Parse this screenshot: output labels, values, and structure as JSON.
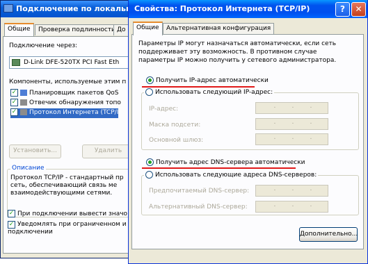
{
  "back_window": {
    "title": "Подключение по локальной",
    "tabs": [
      "Общие",
      "Проверка подлинности",
      "До"
    ],
    "connect_via_label": "Подключение через:",
    "adapter_name": "D-Link DFE-520TX PCI Fast Eth",
    "components_label": "Компоненты, используемые этим п",
    "components": [
      {
        "label": "Планировщик пакетов QoS",
        "checked": true
      },
      {
        "label": "Отвечик обнаружения топо",
        "checked": true
      },
      {
        "label": "Протокол Интернета (TCP/I",
        "checked": true
      }
    ],
    "install_button": "Установить...",
    "remove_button": "Удалить",
    "description_title": "Описание",
    "description_text": "Протокол TCP/IP - стандартный пр сеть, обеспечивающий связь ме взаимодействующими сетями.",
    "show_icon_label": "При подключении вывести значо",
    "notify_label": "Уведомлять при ограниченном и подключении"
  },
  "dialog": {
    "title": "Свойства: Протокол Интернета (TCP/IP)",
    "help_glyph": "?",
    "close_glyph": "✕",
    "tabs": [
      "Общие",
      "Альтернативная конфигурация"
    ],
    "description": "Параметры IP могут назначаться автоматически, если сеть поддерживает эту возможность. В противном случае параметры IP можно получить у сетевого администратора.",
    "ip_auto_label": "Получить IP-адрес автоматически",
    "ip_manual_label": "Использовать следующий IP-адрес:",
    "ip_fields": [
      "IP-адрес:",
      "Маска подсети:",
      "Основной шлюз:"
    ],
    "dns_auto_label": "Получить адрес DNS-сервера автоматически",
    "dns_manual_label": "Использовать следующие адреса DNS-серверов:",
    "dns_fields": [
      "Предпочитаемый DNS-сервер:",
      "Альтернативный DNS-сервер:"
    ],
    "advanced_button": "Дополнительно...",
    "ip_dots": "."
  },
  "colors": {
    "underline": "#e01818",
    "accent_tab": "#e68b2c",
    "titlebar": "#0053ee"
  }
}
